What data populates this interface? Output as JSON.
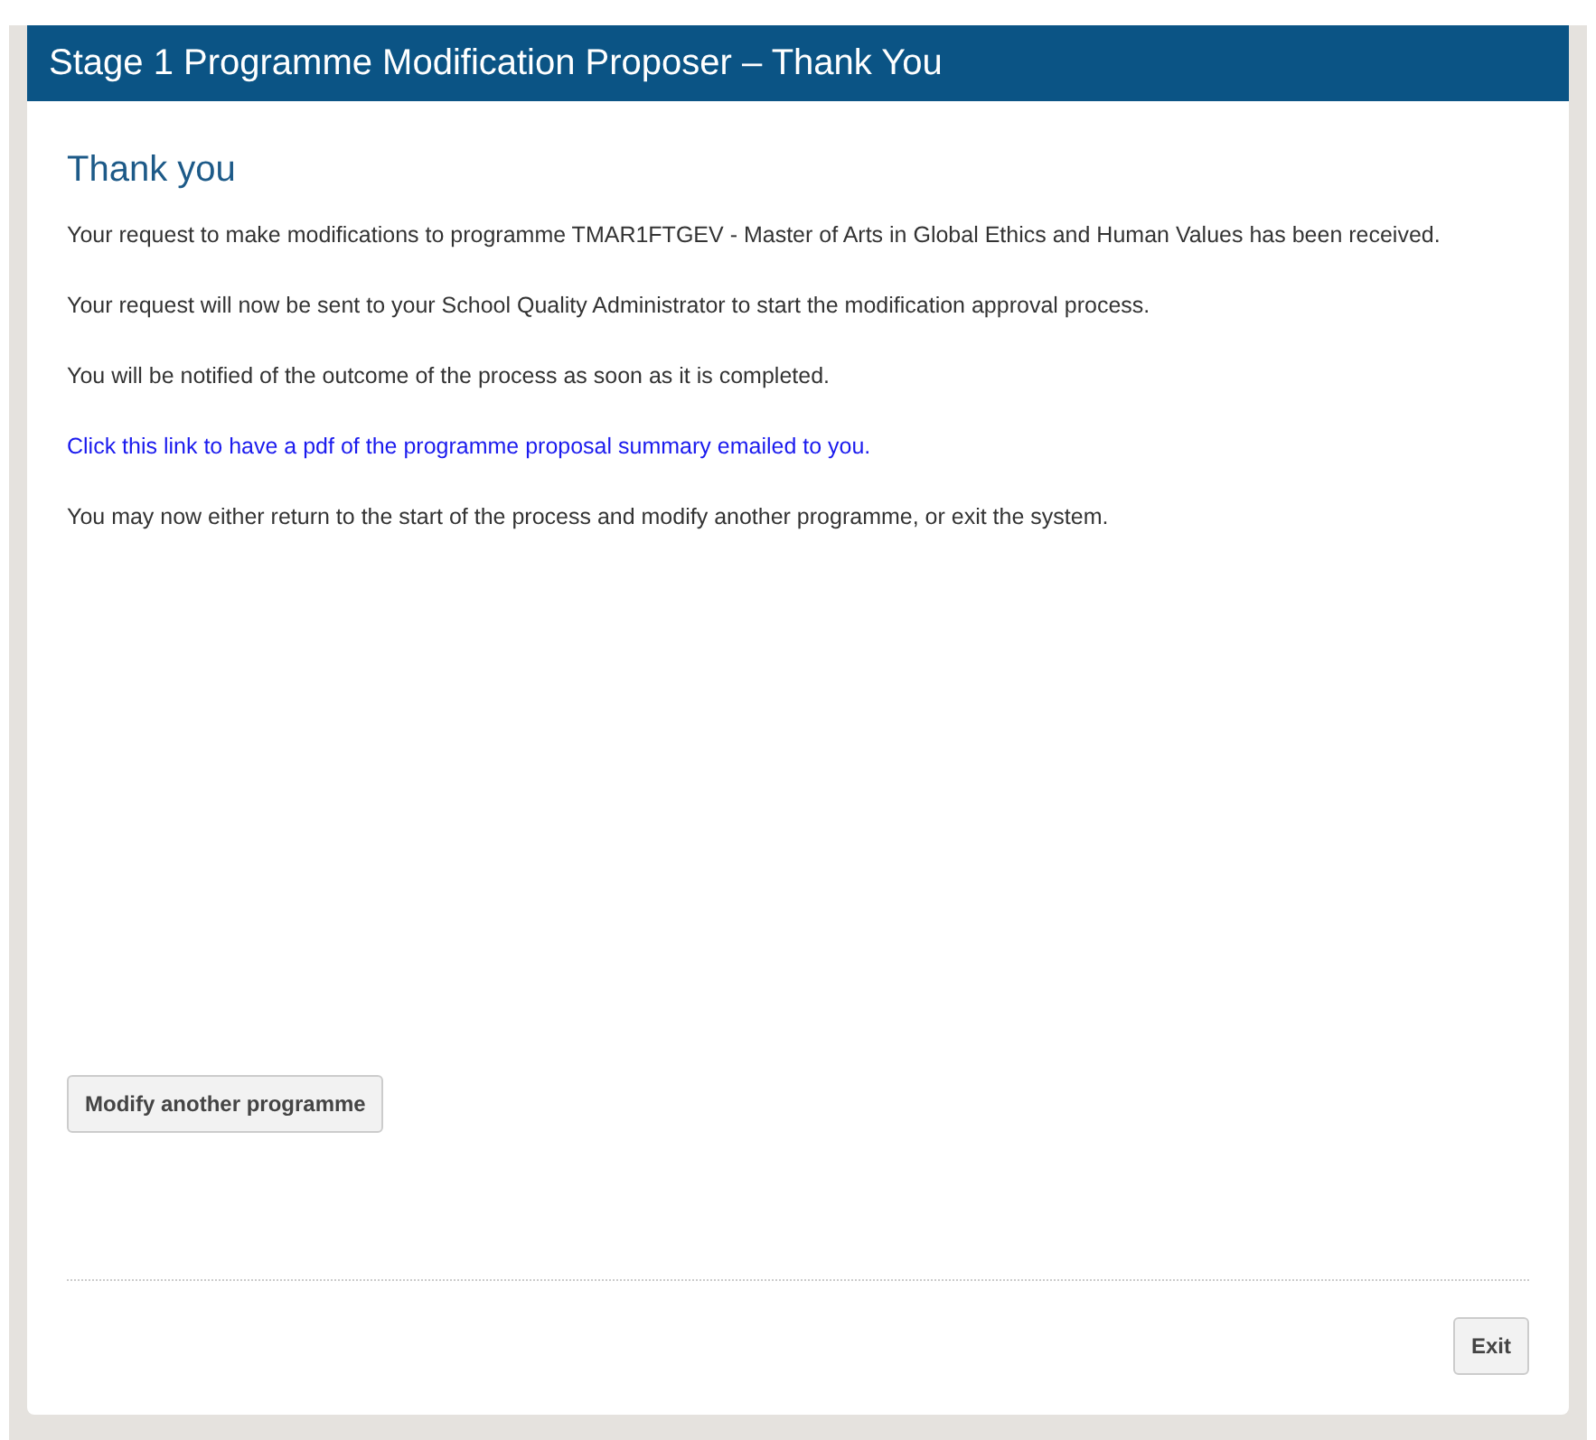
{
  "header": {
    "title": "Stage 1 Programme Modification Proposer – Thank You"
  },
  "heading": "Thank you",
  "paragraphs": [
    {
      "kind": "text",
      "text": "Your request to make modifications to programme TMAR1FTGEV - Master of Arts in Global Ethics and Human Values has been received."
    },
    {
      "kind": "text",
      "text": "Your request will now be sent to your School Quality Administrator to start the modification approval process."
    },
    {
      "kind": "text",
      "text": "You will be notified of the outcome of the process as soon as it is completed."
    },
    {
      "kind": "link",
      "text": "Click this link to have a pdf of the programme proposal summary emailed to you."
    },
    {
      "kind": "text",
      "text": "You may now either return to the start of the process and modify another programme, or exit the system."
    }
  ],
  "buttons": {
    "modify": "Modify another programme",
    "exit": "Exit"
  }
}
